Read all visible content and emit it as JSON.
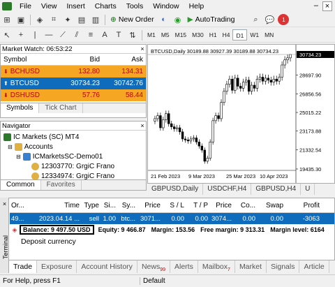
{
  "menu": {
    "items": [
      "File",
      "View",
      "Insert",
      "Charts",
      "Tools",
      "Window",
      "Help"
    ]
  },
  "toolbar": {
    "new_order": "New Order",
    "autotrading": "AutoTrading",
    "timeframes": [
      "M1",
      "M5",
      "M15",
      "M30",
      "H1",
      "H4",
      "D1",
      "W1",
      "MN"
    ],
    "active_timeframe": "D1"
  },
  "market_watch": {
    "title": "Market Watch: 06:53:22",
    "headers": {
      "symbol": "Symbol",
      "bid": "Bid",
      "ask": "Ask"
    },
    "rows": [
      {
        "symbol": "BCHUSD",
        "bid": "132.80",
        "ask": "134.31",
        "bg": "#f5a623",
        "color": "#c00000"
      },
      {
        "symbol": "BTCUSD",
        "bid": "30734.23",
        "ask": "30742.76",
        "bg": "#0f6cbd",
        "color": "#ffffff"
      },
      {
        "symbol": "DSHUSD",
        "bid": "57.76",
        "ask": "58.44",
        "bg": "#f5a623",
        "color": "#c00000"
      }
    ],
    "tabs": [
      "Symbols",
      "Tick Chart"
    ]
  },
  "navigator": {
    "title": "Navigator",
    "root": "IC Markets (SC) MT4",
    "accounts_label": "Accounts",
    "server": "ICMarketsSC-Demo01",
    "accounts": [
      "12303770: GrgiC Frano",
      "12334974: GrgiC Frano"
    ],
    "tabs": [
      "Common",
      "Favorites"
    ]
  },
  "chart": {
    "header": "BTCUSD,Daily 30189.88 30927.39 30189.88 30734.23",
    "current_price": "30734.23",
    "price_axis": [
      "28697.90",
      "26856.56",
      "25015.22",
      "23173.88",
      "21332.54",
      "19435.30"
    ],
    "date_axis": [
      "21 Feb 2023",
      "9 Mar 2023",
      "25 Mar 2023",
      "10 Apr 2023"
    ],
    "tabs": [
      "GBPUSD,Daily",
      "USDCHF,H4",
      "GBPUSD,H4",
      "U"
    ]
  },
  "chart_data": {
    "type": "candlestick",
    "symbol": "BTCUSD",
    "timeframe": "Daily",
    "ohlc_last": {
      "open": 30189.88,
      "high": 30927.39,
      "low": 30189.88,
      "close": 30734.23
    },
    "ylim": [
      19435.3,
      30734.23
    ],
    "closes": [
      24400,
      24700,
      23500,
      24300,
      24900,
      23900,
      23600,
      23400,
      23500,
      23100,
      22400,
      22300,
      22200,
      22400,
      22500,
      22100,
      21700,
      21300,
      20200,
      20500,
      22100,
      24200,
      24700,
      24400,
      26000,
      27100,
      27800,
      28300,
      27200,
      28400,
      27600,
      27400,
      28000,
      28200,
      27100,
      27700,
      27400,
      28300,
      28500,
      28100,
      28400,
      28200,
      28000,
      28300,
      28100,
      28500,
      29700,
      30200,
      30400,
      30734
    ]
  },
  "terminal": {
    "headers": [
      "Or...",
      "Time",
      "Type",
      "Si...",
      "Sy...",
      "Price",
      "S / L",
      "T / P",
      "Price",
      "Co...",
      "Swap",
      "Profit"
    ],
    "order_row": [
      "49...",
      "2023.04.14 ...",
      "sell",
      "1.00",
      "btc...",
      "3071...",
      "0.00",
      "0.00",
      "3074...",
      "0.00",
      "0.00",
      "-3063"
    ],
    "balance": "Balance: 9 497.50 USD",
    "equity": "Equity: 9 466.87",
    "margin": "Margin: 153.56",
    "free_margin": "Free margin: 9 313.31",
    "margin_level": "Margin level: 6164",
    "deposit_currency": "Deposit currency",
    "side_label": "Terminal",
    "tabs": [
      {
        "label": "Trade",
        "badge": ""
      },
      {
        "label": "Exposure",
        "badge": ""
      },
      {
        "label": "Account History",
        "badge": ""
      },
      {
        "label": "News",
        "badge": "99"
      },
      {
        "label": "Alerts",
        "badge": ""
      },
      {
        "label": "Mailbox",
        "badge": "7"
      },
      {
        "label": "Market",
        "badge": ""
      },
      {
        "label": "Signals",
        "badge": ""
      },
      {
        "label": "Article",
        "badge": ""
      }
    ]
  },
  "status": {
    "help": "For Help, press F1",
    "profile": "Default"
  }
}
